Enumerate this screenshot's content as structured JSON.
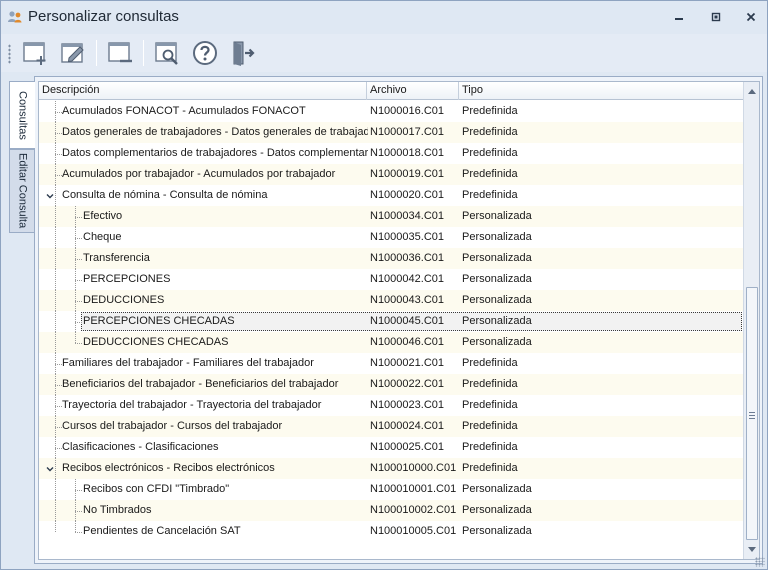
{
  "window": {
    "title": "Personalizar consultas",
    "accent": "#3a6ea5"
  },
  "toolbar": {
    "buttons": [
      {
        "name": "new-query-button",
        "icon": "new-window-plus-icon"
      },
      {
        "name": "edit-query-button",
        "icon": "edit-pencil-icon"
      },
      {
        "name": "delete-query-button",
        "icon": "window-minus-icon"
      },
      {
        "name": "preview-query-button",
        "icon": "window-search-icon"
      },
      {
        "name": "help-button",
        "icon": "question-circle-icon"
      },
      {
        "name": "exit-button",
        "icon": "exit-door-icon"
      }
    ]
  },
  "side_tabs": [
    {
      "label": "Consultas",
      "active": true
    },
    {
      "label": "Editar Consulta",
      "active": false
    }
  ],
  "grid": {
    "columns": [
      "Descripción",
      "Archivo",
      "Tipo"
    ],
    "rows": [
      {
        "desc": "Acumulados FONACOT - Acumulados FONACOT",
        "file": "N1000016.C01",
        "type": "Predefinida",
        "level": 0
      },
      {
        "desc": "Datos generales de trabajadores - Datos generales de trabajador",
        "file": "N1000017.C01",
        "type": "Predefinida",
        "level": 0
      },
      {
        "desc": "Datos complementarios de trabajadores - Datos complementarios",
        "file": "N1000018.C01",
        "type": "Predefinida",
        "level": 0
      },
      {
        "desc": "Acumulados por trabajador - Acumulados por trabajador",
        "file": "N1000019.C01",
        "type": "Predefinida",
        "level": 0
      },
      {
        "desc": "Consulta de nómina - Consulta de nómina",
        "file": "N1000020.C01",
        "type": "Predefinida",
        "level": 0,
        "expanded": true
      },
      {
        "desc": "Efectivo",
        "file": "N1000034.C01",
        "type": "Personalizada",
        "level": 1
      },
      {
        "desc": "Cheque",
        "file": "N1000035.C01",
        "type": "Personalizada",
        "level": 1
      },
      {
        "desc": "Transferencia",
        "file": "N1000036.C01",
        "type": "Personalizada",
        "level": 1
      },
      {
        "desc": "PERCEPCIONES",
        "file": "N1000042.C01",
        "type": "Personalizada",
        "level": 1
      },
      {
        "desc": "DEDUCCIONES",
        "file": "N1000043.C01",
        "type": "Personalizada",
        "level": 1
      },
      {
        "desc": "PERCEPCIONES CHECADAS",
        "file": "N1000045.C01",
        "type": "Personalizada",
        "level": 1,
        "selected": true
      },
      {
        "desc": "DEDUCCIONES CHECADAS",
        "file": "N1000046.C01",
        "type": "Personalizada",
        "level": 1
      },
      {
        "desc": "Familiares del trabajador - Familiares del trabajador",
        "file": "N1000021.C01",
        "type": "Predefinida",
        "level": 0
      },
      {
        "desc": "Beneficiarios del trabajador - Beneficiarios del trabajador",
        "file": "N1000022.C01",
        "type": "Predefinida",
        "level": 0
      },
      {
        "desc": "Trayectoria del trabajador - Trayectoria del trabajador",
        "file": "N1000023.C01",
        "type": "Predefinida",
        "level": 0
      },
      {
        "desc": "Cursos del trabajador - Cursos del trabajador",
        "file": "N1000024.C01",
        "type": "Predefinida",
        "level": 0
      },
      {
        "desc": "Clasificaciones - Clasificaciones",
        "file": "N1000025.C01",
        "type": "Predefinida",
        "level": 0
      },
      {
        "desc": "Recibos electrónicos - Recibos electrónicos",
        "file": "N100010000.C01",
        "type": "Predefinida",
        "level": 0,
        "expanded": true
      },
      {
        "desc": "Recibos con CFDI \"Timbrado\"",
        "file": "N100010001.C01",
        "type": "Personalizada",
        "level": 1
      },
      {
        "desc": "No Timbrados",
        "file": "N100010002.C01",
        "type": "Personalizada",
        "level": 1
      },
      {
        "desc": "Pendientes de Cancelación SAT",
        "file": "N100010005.C01",
        "type": "Personalizada",
        "level": 1
      }
    ]
  }
}
